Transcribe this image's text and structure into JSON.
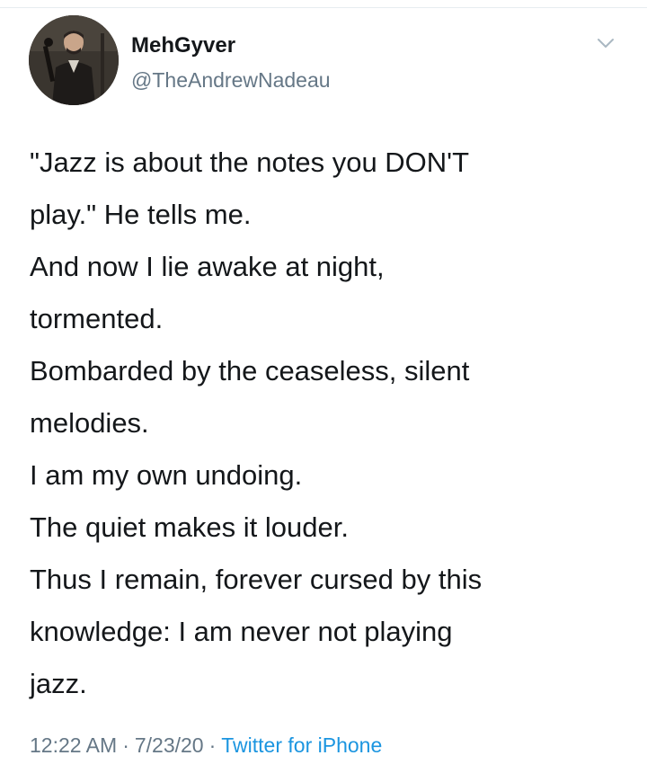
{
  "user": {
    "display_name": "MehGyver",
    "handle": "@TheAndrewNadeau",
    "avatar_icon": "profile-photo"
  },
  "menu": {
    "icon": "chevron-down-icon"
  },
  "tweet": {
    "lines": [
      "\"Jazz is about the notes you DON'T",
      "play.\" He tells me.",
      "And now I lie awake at night,",
      "tormented.",
      "Bombarded by the ceaseless, silent",
      "melodies.",
      "I am my own undoing.",
      "The quiet makes it louder.",
      "Thus I remain, forever cursed by this",
      "knowledge: I am never not playing",
      "jazz."
    ]
  },
  "meta": {
    "time": "12:22 AM",
    "date": "7/23/20",
    "separator": "·",
    "source": "Twitter for iPhone"
  },
  "colors": {
    "text_primary": "#14171a",
    "text_secondary": "#657786",
    "link": "#1b95e0"
  }
}
